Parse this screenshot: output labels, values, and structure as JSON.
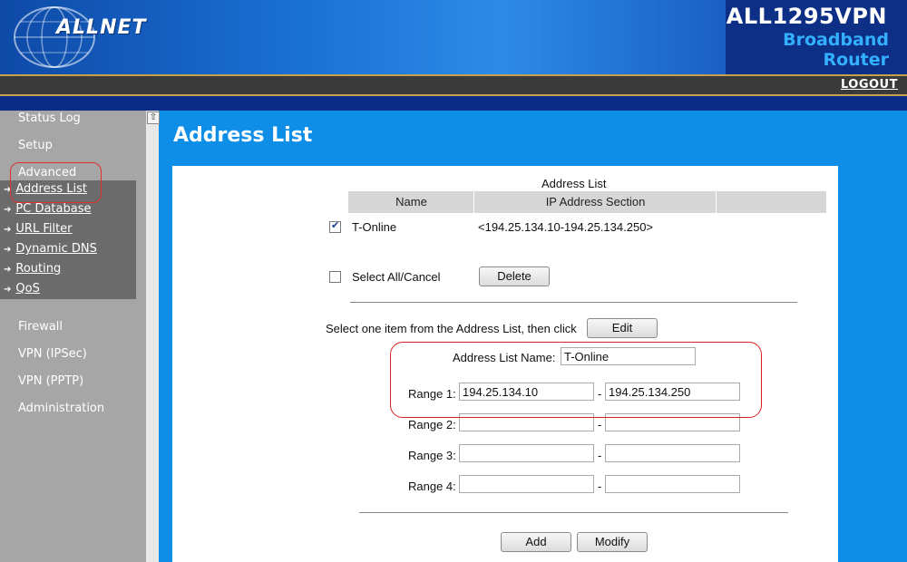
{
  "header": {
    "brand": "ALLNET",
    "product": "ALL1295VPN",
    "subtitle_line1": "Broadband",
    "subtitle_line2": "Router",
    "logout": "LOGOUT"
  },
  "sidebar": {
    "items": [
      {
        "label": "Status Log"
      },
      {
        "label": "Setup"
      },
      {
        "label": "Advanced"
      }
    ],
    "advanced_sub": [
      {
        "label": "Address List"
      },
      {
        "label": "PC Database"
      },
      {
        "label": "URL Filter"
      },
      {
        "label": "Dynamic DNS"
      },
      {
        "label": "Routing"
      },
      {
        "label": "QoS"
      }
    ],
    "lower_items": [
      {
        "label": "Firewall"
      },
      {
        "label": "VPN (IPSec)"
      },
      {
        "label": "VPN (PPTP)"
      },
      {
        "label": "Administration"
      }
    ]
  },
  "page": {
    "title": "Address List",
    "table_caption": "Address List",
    "columns": [
      "Name",
      "IP Address Section"
    ],
    "rows": [
      {
        "checked": true,
        "name": "T-Online",
        "section": "<194.25.134.10-194.25.134.250>"
      }
    ],
    "select_all_label": "Select All/Cancel",
    "delete_label": "Delete",
    "edit_prompt": "Select one item from the Address List, then click",
    "edit_label": "Edit",
    "name_label": "Address List Name:",
    "name_value": "T-Online",
    "ranges": [
      {
        "label": "Range 1:",
        "from": "194.25.134.10",
        "to": "194.25.134.250"
      },
      {
        "label": "Range 2:",
        "from": "",
        "to": ""
      },
      {
        "label": "Range 3:",
        "from": "",
        "to": ""
      },
      {
        "label": "Range 4:",
        "from": "",
        "to": ""
      }
    ],
    "range_sep": "-",
    "add_label": "Add",
    "modify_label": "Modify"
  }
}
